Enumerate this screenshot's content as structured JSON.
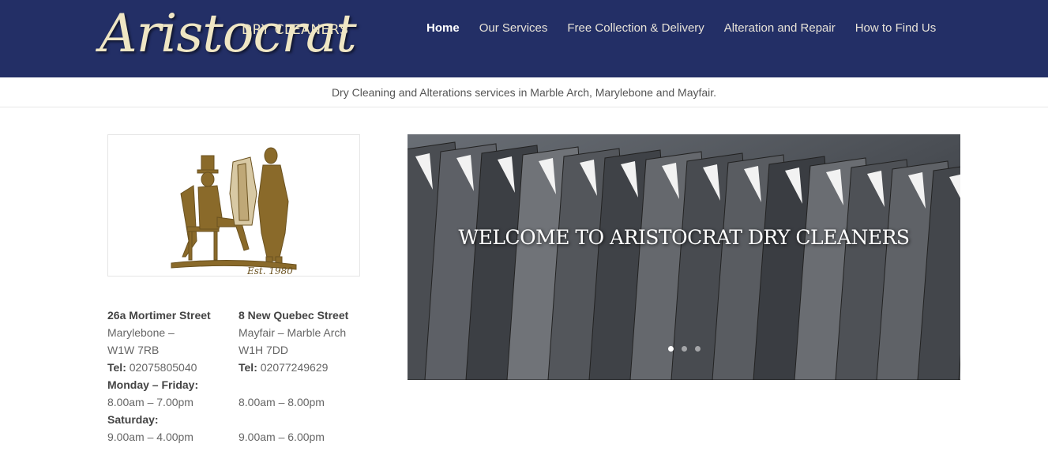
{
  "logo": {
    "script": "Aristocrat",
    "sub": "DRY CLEANERS"
  },
  "nav": [
    {
      "label": "Home"
    },
    {
      "label": "Our Services"
    },
    {
      "label": "Free Collection & Delivery"
    },
    {
      "label": "Alteration and Repair"
    },
    {
      "label": "How to Find Us"
    }
  ],
  "tagline": "Dry Cleaning and Alterations services in Marble Arch, Marylebone and Mayfair.",
  "crest": {
    "est": "Est. 1980"
  },
  "branch1": {
    "street": "26a Mortimer Street",
    "area": "Marylebone –",
    "postcode": "W1W 7RB",
    "tel_label": "Tel:",
    "tel": "02075805040",
    "days1": "Monday – Friday:",
    "hours1": "8.00am – 7.00pm",
    "days2": "Saturday:",
    "hours2": "9.00am – 4.00pm"
  },
  "branch2": {
    "street": "8 New Quebec Street",
    "area": "Mayfair – Marble Arch",
    "postcode": "W1H 7DD",
    "tel_label": "Tel:",
    "tel": "02077249629",
    "hours1": "8.00am – 8.00pm",
    "hours2": "9.00am – 6.00pm"
  },
  "slider": {
    "title": "WELCOME TO ARISTOCRAT DRY CLEANERS",
    "active_slide": 1,
    "slide_count": 3
  },
  "colors": {
    "header": "#232f66",
    "logo": "#efe6c4",
    "crest": "#8a6a2a"
  }
}
